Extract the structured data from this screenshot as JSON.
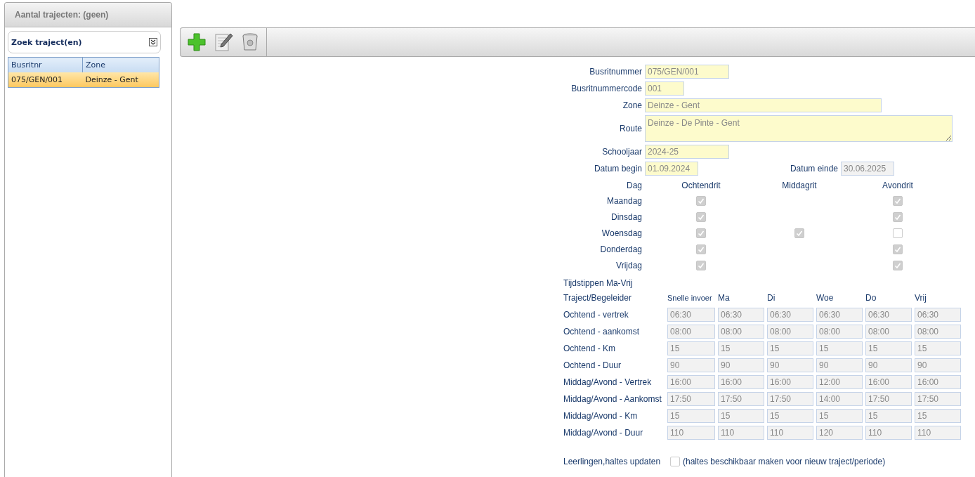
{
  "left_panel": {
    "title": "Aantal trajecten: (geen)",
    "search": {
      "title": "Zoek traject(en)",
      "expanded": false
    },
    "table": {
      "columns": [
        "Busritnr",
        "Zone"
      ],
      "rows": [
        {
          "cells": [
            "075/GEN/001",
            "Deinze - Gent"
          ],
          "selected": true
        }
      ]
    }
  },
  "toolbar": {
    "buttons": [
      {
        "kind": "add"
      },
      {
        "kind": "edit"
      },
      {
        "kind": "delete"
      }
    ]
  },
  "form": {
    "fields": [
      {
        "label": "Busritnummer",
        "value": "075/GEN/001",
        "kind": "medium"
      },
      {
        "label": "Busritnummercode",
        "value": "001",
        "kind": "small"
      },
      {
        "label": "Zone",
        "value": "Deinze - Gent",
        "kind": "wide"
      },
      {
        "label": "Route",
        "value": "Deinze - De Pinte - Gent",
        "kind": "textarea"
      },
      {
        "label": "Schooljaar",
        "value": "2024-25",
        "kind": "medium"
      }
    ],
    "dates": [
      {
        "label": "Datum begin",
        "value": "01.09.2024",
        "disabled": false
      },
      {
        "label": "Datum einde",
        "value": "30.06.2025",
        "disabled": true
      }
    ],
    "days": {
      "label": "Dag",
      "columns": [
        "Ochtendrit",
        "Middagrit",
        "Avondrit"
      ],
      "rows": [
        {
          "day": "Maandag",
          "morning": true,
          "evening": true
        },
        {
          "day": "Dinsdag",
          "morning": true,
          "evening": true
        },
        {
          "day": "Woensdag",
          "morning": true,
          "midday": true,
          "evening": false
        },
        {
          "day": "Donderdag",
          "morning": true,
          "evening": true
        },
        {
          "day": "Vrijdag",
          "morning": true,
          "evening": true
        }
      ]
    },
    "times": {
      "title": "Tijdstippen Ma-Vrij",
      "header": [
        "Traject/Begeleider",
        "Snelle invoer",
        "Ma",
        "Di",
        "Woe",
        "Do",
        "Vrij"
      ],
      "rows": [
        {
          "label": "Ochtend - vertrek",
          "values": [
            "06:30",
            "06:30",
            "06:30",
            "06:30",
            "06:30",
            "06:30"
          ]
        },
        {
          "label": "Ochtend - aankomst",
          "values": [
            "08:00",
            "08:00",
            "08:00",
            "08:00",
            "08:00",
            "08:00"
          ]
        },
        {
          "label": "Ochtend - Km",
          "values": [
            "15",
            "15",
            "15",
            "15",
            "15",
            "15"
          ]
        },
        {
          "label": "Ochtend - Duur",
          "values": [
            "90",
            "90",
            "90",
            "90",
            "90",
            "90"
          ]
        },
        {
          "label": "Middag/Avond - Vertrek",
          "values": [
            "16:00",
            "16:00",
            "16:00",
            "12:00",
            "16:00",
            "16:00"
          ]
        },
        {
          "label": "Middag/Avond - Aankomst",
          "values": [
            "17:50",
            "17:50",
            "17:50",
            "14:00",
            "17:50",
            "17:50"
          ]
        },
        {
          "label": "Middag/Avond - Km",
          "values": [
            "15",
            "15",
            "15",
            "15",
            "15",
            "15"
          ]
        },
        {
          "label": "Middag/Avond - Duur",
          "values": [
            "110",
            "110",
            "110",
            "120",
            "110",
            "110"
          ]
        }
      ]
    },
    "update": {
      "label": "Leerlingen,haltes updaten",
      "checked": false,
      "note": "(haltes beschikbaar maken voor nieuw traject/periode)"
    }
  }
}
